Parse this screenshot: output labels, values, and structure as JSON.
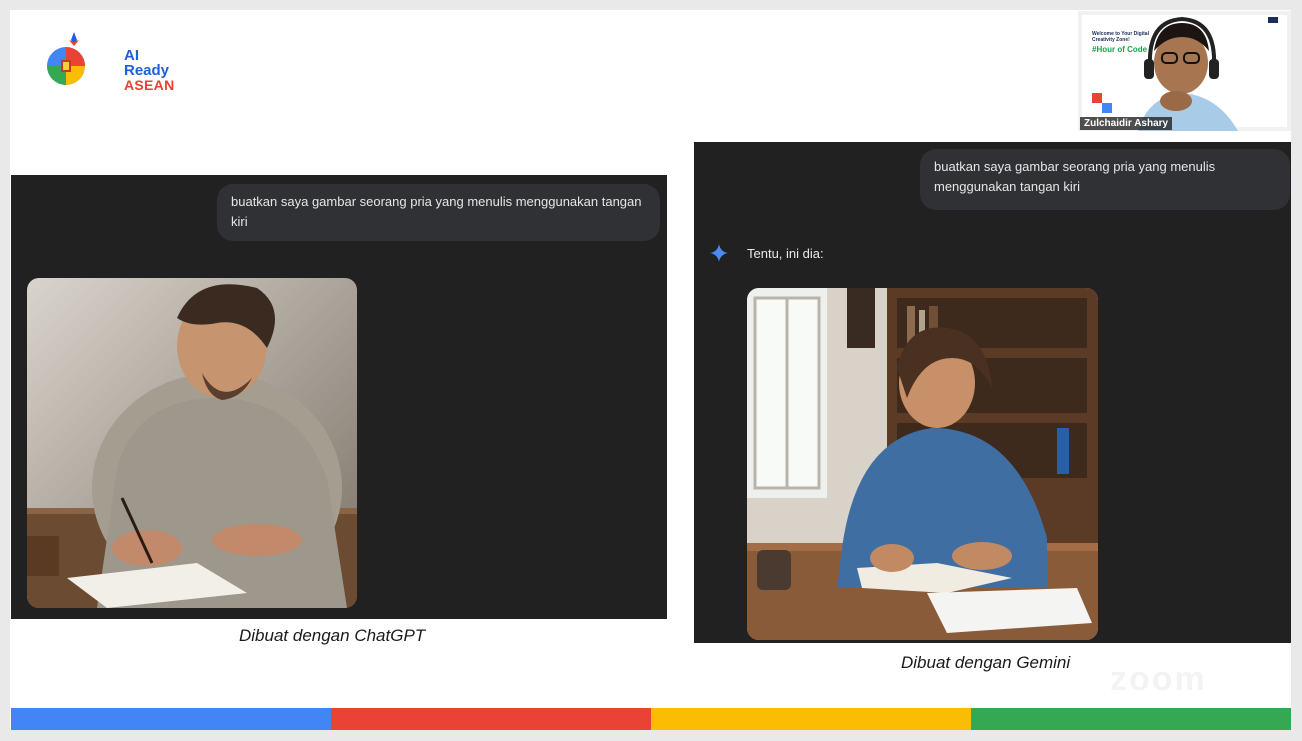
{
  "logo": {
    "line1": "AI Ready",
    "line2": "ASEAN"
  },
  "left_panel": {
    "prompt": "buatkan saya gambar seorang pria yang menulis menggunakan tangan kiri",
    "caption": "Dibuat dengan ChatGPT"
  },
  "right_panel": {
    "prompt": "buatkan saya gambar seorang pria yang menulis menggunakan tangan kiri",
    "reply": "Tentu, ini dia:",
    "caption": "Dibuat dengan Gemini"
  },
  "webcam": {
    "participant_name": "Zulchaidir Ashary",
    "banner_line1": "Welcome to Your Digital",
    "banner_line2": "Creativity Zone!",
    "banner_hashtag": "#Hour of Code"
  },
  "watermark": "zoom",
  "colors": {
    "bar_blue": "#4285f4",
    "bar_red": "#ea4335",
    "bar_yellow": "#fbbc04",
    "bar_green": "#34a853",
    "panel_bg": "#212121",
    "bubble_bg": "#303134",
    "gemini_star": "#4a8af4"
  }
}
